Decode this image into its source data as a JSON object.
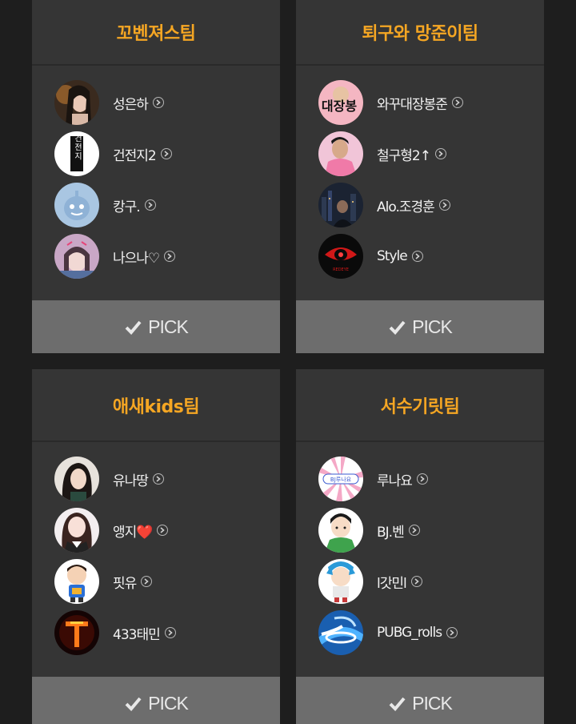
{
  "teams": [
    {
      "title": "꼬벤져스팀",
      "members": [
        {
          "name": "성은하",
          "avatar": "avatar-girl-dark-hair"
        },
        {
          "name": "건전지2",
          "avatar": "avatar-text-logo"
        },
        {
          "name": "캉구.",
          "avatar": "avatar-blue-cartoon"
        },
        {
          "name": "나으나♡",
          "avatar": "avatar-girl-pink-filter"
        }
      ],
      "pick_label": "PICK"
    },
    {
      "title": "퇴구와 망준이팀",
      "members": [
        {
          "name": "와꾸대장봉준",
          "avatar": "avatar-pink-text-logo"
        },
        {
          "name": "철구형2↑",
          "avatar": "avatar-man-pink-shirt"
        },
        {
          "name": "Alo.조경훈",
          "avatar": "avatar-night-city"
        },
        {
          "name": "Style",
          "avatar": "avatar-red-eye-logo"
        }
      ],
      "pick_label": "PICK"
    },
    {
      "title": "애새kids팀",
      "members": [
        {
          "name": "유나땅",
          "avatar": "avatar-girl-long-hair"
        },
        {
          "name": "앵지❤️",
          "avatar": "avatar-girl-school-uniform"
        },
        {
          "name": "핏유",
          "avatar": "avatar-cartoon-boy"
        },
        {
          "name": "433태민",
          "avatar": "avatar-fire-t-logo"
        }
      ],
      "pick_label": "PICK"
    },
    {
      "title": "서수기릿팀",
      "members": [
        {
          "name": "루나요",
          "avatar": "avatar-pink-burst-logo"
        },
        {
          "name": "BJ.벤",
          "avatar": "avatar-cartoon-boy-green"
        },
        {
          "name": "l갓민l",
          "avatar": "avatar-cartoon-blue-hair"
        },
        {
          "name": "PUBG_rolls",
          "avatar": "avatar-blue-swirl-logo"
        }
      ],
      "pick_label": "PICK"
    }
  ],
  "avatar_texts": {
    "t1_m2": "건전지",
    "t2_m1": "대장봉",
    "t2_m4": "REDEYE",
    "t4_m1": "BJ루나요"
  },
  "colors": {
    "page_bg": "#1e1e1e",
    "card_bg": "#353535",
    "title": "#f5a623",
    "pick_bg": "#6d6d6d",
    "name": "#f2f2f2"
  }
}
